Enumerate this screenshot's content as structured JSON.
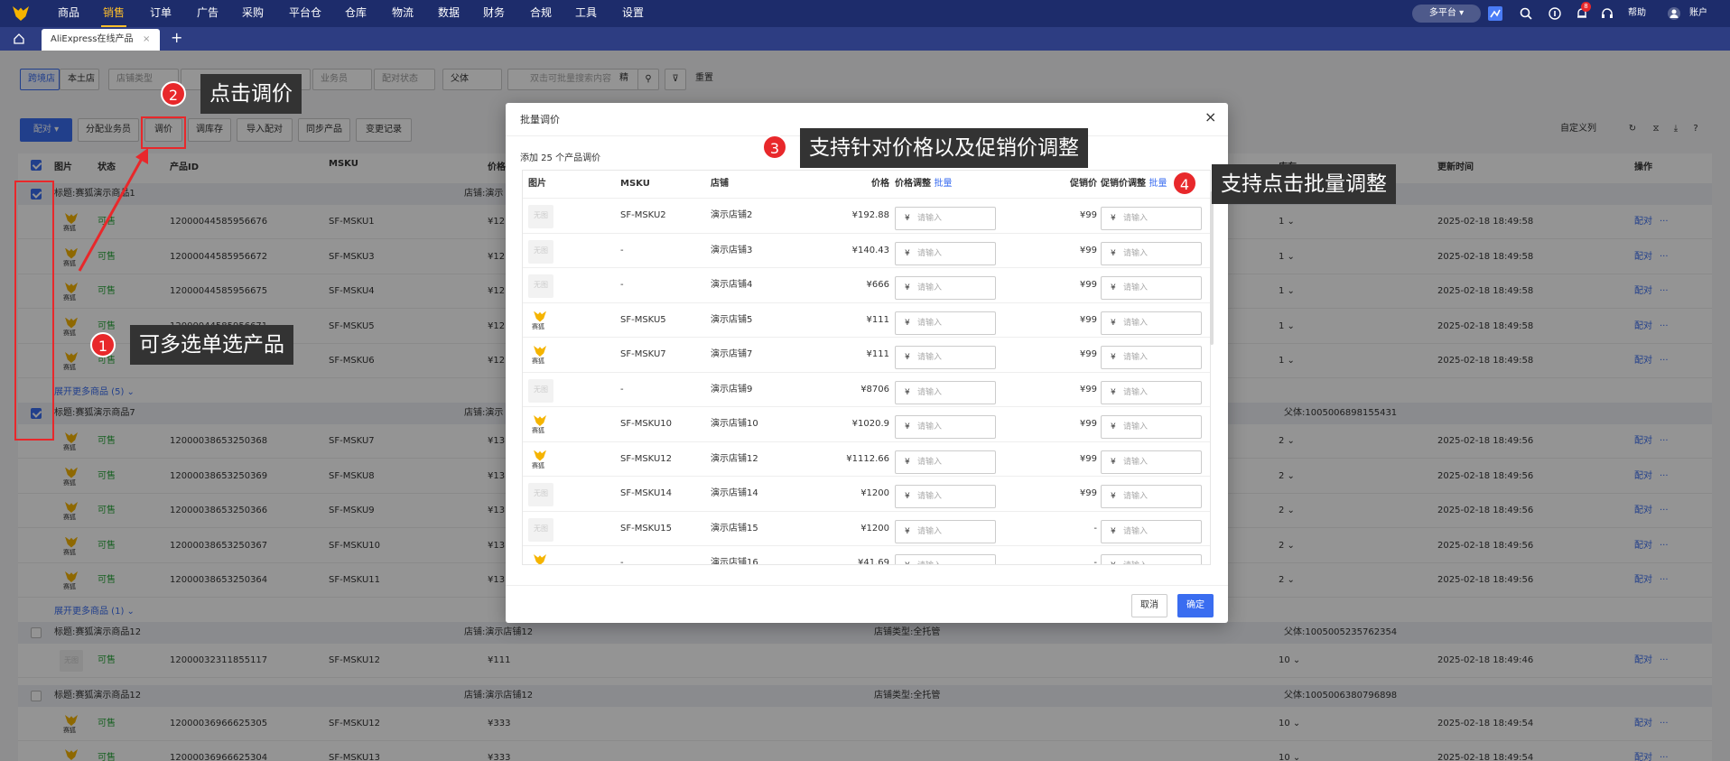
{
  "nav": {
    "items": [
      "商品",
      "销售",
      "订单",
      "广告",
      "采购",
      "平台仓",
      "仓库",
      "物流",
      "数据",
      "财务",
      "合规",
      "工具",
      "设置"
    ],
    "active_index": 1,
    "platform": "多平台",
    "notif_count": "8",
    "help": "帮助",
    "account": "账户"
  },
  "tabs": {
    "active": "AliExpress在线产品"
  },
  "filters": {
    "tab_cross": "跨境店",
    "tab_local": "本土店",
    "shop_type": "店铺类型",
    "operator": "业务员",
    "match_status": "配对状态",
    "parent": "父体",
    "search_placeholder": "双击可批量搜索内容",
    "precise": "精",
    "reset": "重置"
  },
  "toolbar": {
    "match": "配对",
    "assign": "分配业务员",
    "adjust_price": "调价",
    "adjust_stock": "调库存",
    "import_match": "导入配对",
    "sync": "同步产品",
    "change_log": "变更记录",
    "custom_cols": "自定义列"
  },
  "table": {
    "headers": {
      "image": "图片",
      "status": "状态",
      "product_id": "产品ID",
      "msku": "MSKU",
      "price": "价格",
      "stock": "库存",
      "updated": "更新时间",
      "ops": "操作"
    },
    "groups": [
      {
        "title": "标题:赛狐演示商品1",
        "shop": "店铺:演示",
        "parent": ""
      },
      {
        "title": "标题:赛狐演示商品7",
        "shop": "店铺:演示",
        "parent": "父体:1005006898155431"
      },
      {
        "title": "标题:赛狐演示商品12",
        "shop": "店铺:演示店铺12",
        "shop_type": "店铺类型:全托管",
        "parent": "父体:1005005235762354"
      },
      {
        "title": "标题:赛狐演示商品12",
        "shop": "店铺:演示店铺12",
        "shop_type": "店铺类型:全托管",
        "parent": "父体:1005006380796898"
      }
    ],
    "rows1": [
      {
        "status": "可售",
        "id": "12000044585956676",
        "msku": "SF-MSKU1",
        "price": "¥12",
        "stock": "1",
        "time": "2025-02-18 18:49:58"
      },
      {
        "status": "可售",
        "id": "12000044585956672",
        "msku": "SF-MSKU3",
        "price": "¥12",
        "stock": "1",
        "time": "2025-02-18 18:49:58"
      },
      {
        "status": "可售",
        "id": "12000044585956675",
        "msku": "SF-MSKU4",
        "price": "¥12",
        "stock": "1",
        "time": "2025-02-18 18:49:58"
      },
      {
        "status": "可售",
        "id": "12000044585956671",
        "msku": "SF-MSKU5",
        "price": "¥12",
        "stock": "1",
        "time": "2025-02-18 18:49:58"
      },
      {
        "status": "可售",
        "id": "12000044585956674",
        "msku": "SF-MSKU6",
        "price": "¥12",
        "stock": "1",
        "time": "2025-02-18 18:49:58"
      }
    ],
    "more1": "展开更多商品 (5)",
    "rows2": [
      {
        "status": "可售",
        "id": "12000038653250368",
        "msku": "SF-MSKU7",
        "price": "¥13",
        "stock": "2",
        "time": "2025-02-18 18:49:56"
      },
      {
        "status": "可售",
        "id": "12000038653250369",
        "msku": "SF-MSKU8",
        "price": "¥13",
        "stock": "2",
        "time": "2025-02-18 18:49:56"
      },
      {
        "status": "可售",
        "id": "12000038653250366",
        "msku": "SF-MSKU9",
        "price": "¥13",
        "stock": "2",
        "time": "2025-02-18 18:49:56"
      },
      {
        "status": "可售",
        "id": "12000038653250367",
        "msku": "SF-MSKU10",
        "price": "¥13",
        "stock": "2",
        "time": "2025-02-18 18:49:56"
      },
      {
        "status": "可售",
        "id": "12000038653250364",
        "msku": "SF-MSKU11",
        "price": "¥13",
        "stock": "2",
        "time": "2025-02-18 18:49:56"
      }
    ],
    "more2": "展开更多商品 (1)",
    "row3": {
      "status": "可售",
      "id": "12000032311855117",
      "msku": "SF-MSKU12",
      "price": "¥111",
      "stock": "10",
      "time": "2025-02-18 18:49:46"
    },
    "row4": {
      "status": "可售",
      "id": "12000036966625305",
      "msku": "SF-MSKU12",
      "price": "¥333",
      "stock": "10",
      "time": "2025-02-18 18:49:54"
    },
    "row5": {
      "status": "可售",
      "id": "12000036966625304",
      "msku": "SF-MSKU13",
      "price": "¥333",
      "stock": "10",
      "time": "2025-02-18 18:49:54"
    },
    "op_match": "配对",
    "dash": "-"
  },
  "dialog": {
    "title": "批量调价",
    "summary": "添加 25 个产品调价",
    "headers": {
      "image": "图片",
      "msku": "MSKU",
      "shop": "店铺",
      "price": "价格",
      "price_adj": "价格调整",
      "batch": "批量",
      "promo": "促销价",
      "promo_adj": "促销价调整"
    },
    "placeholder": "请输入",
    "cancel": "取消",
    "ok": "确定",
    "rows": [
      {
        "img": "none",
        "msku": "SF-MSKU2",
        "shop": "演示店铺2",
        "price": "¥192.88",
        "promo": "¥99"
      },
      {
        "img": "none",
        "msku": "-",
        "shop": "演示店铺3",
        "price": "¥140.43",
        "promo": "¥99"
      },
      {
        "img": "none",
        "msku": "-",
        "shop": "演示店铺4",
        "price": "¥666",
        "promo": "¥99"
      },
      {
        "img": "fox",
        "msku": "SF-MSKU5",
        "shop": "演示店铺5",
        "price": "¥111",
        "promo": "¥99"
      },
      {
        "img": "fox",
        "msku": "SF-MSKU7",
        "shop": "演示店铺7",
        "price": "¥111",
        "promo": "¥99"
      },
      {
        "img": "none",
        "msku": "-",
        "shop": "演示店铺9",
        "price": "¥8706",
        "promo": "¥99"
      },
      {
        "img": "fox",
        "msku": "SF-MSKU10",
        "shop": "演示店铺10",
        "price": "¥1020.9",
        "promo": "¥99"
      },
      {
        "img": "fox",
        "msku": "SF-MSKU12",
        "shop": "演示店铺12",
        "price": "¥1112.66",
        "promo": "¥99"
      },
      {
        "img": "none",
        "msku": "SF-MSKU14",
        "shop": "演示店铺14",
        "price": "¥1200",
        "promo": "¥99"
      },
      {
        "img": "none",
        "msku": "SF-MSKU15",
        "shop": "演示店铺15",
        "price": "¥1200",
        "promo": "-"
      },
      {
        "img": "fox",
        "msku": "-",
        "shop": "演示店铺16",
        "price": "¥41.69",
        "promo": "-"
      }
    ]
  },
  "annotations": {
    "a1": "可多选单选产品",
    "a2": "点击调价",
    "a3": "支持针对价格以及促销价调整",
    "a4": "支持点击批量调整",
    "n1": "1",
    "n2": "2",
    "n3": "3",
    "n4": "4"
  },
  "no_image": "无图"
}
